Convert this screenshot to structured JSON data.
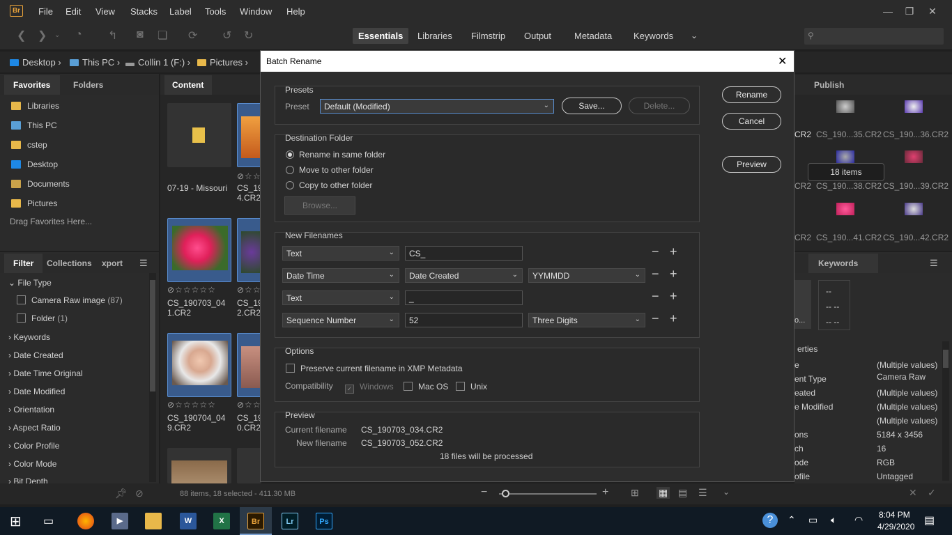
{
  "app": {
    "logo": "Br"
  },
  "menu": [
    "File",
    "Edit",
    "View",
    "Stacks",
    "Label",
    "Tools",
    "Window",
    "Help"
  ],
  "workspaces": [
    "Essentials",
    "Libraries",
    "Filmstrip",
    "Output",
    "Metadata",
    "Keywords"
  ],
  "path": [
    "Desktop",
    "This PC",
    "Collin 1 (F:)",
    "Pictures"
  ],
  "left_panel": {
    "tabs": [
      "Favorites",
      "Folders"
    ],
    "favorites": [
      "Libraries",
      "This PC",
      "cstep",
      "Desktop",
      "Documents",
      "Pictures"
    ],
    "drag_hint": "Drag Favorites Here...",
    "filter_tabs": [
      "Filter",
      "Collections",
      "xport"
    ],
    "filters": {
      "file_type": "File Type",
      "camera_raw": "Camera Raw image",
      "camera_raw_count": "(87)",
      "folder": "Folder",
      "folder_count": "(1)",
      "others": [
        "Keywords",
        "Date Created",
        "Date Time Original",
        "Date Modified",
        "Orientation",
        "Aspect Ratio",
        "Color Profile",
        "Color Mode",
        "Bit Depth"
      ]
    }
  },
  "content": {
    "tab": "Content",
    "items": {
      "folder_caption": "07-19 - Missouri",
      "c2_line1": "CS_19",
      "c2_line2": "4.CR2",
      "r2_line1": "CS_190703_04",
      "r2_line2": "1.CR2",
      "r2b_line1": "CS_19",
      "r2b_line2": "2.CR2",
      "r3_line1": "CS_190704_04",
      "r3_line2": "9.CR2",
      "r3b_line1": "CS_19",
      "r3b_line2": "0.CR2"
    },
    "stars": "⊘☆☆☆☆☆",
    "stars_short": "⊘☆☆"
  },
  "dialog": {
    "title": "Batch Rename",
    "presets": {
      "section": "Presets",
      "label": "Preset",
      "value": "Default (Modified)",
      "save": "Save...",
      "delete": "Delete..."
    },
    "buttons": {
      "rename": "Rename",
      "cancel": "Cancel",
      "preview": "Preview"
    },
    "destination": {
      "section": "Destination Folder",
      "same": "Rename in same folder",
      "move": "Move to other folder",
      "copy": "Copy to other folder",
      "browse": "Browse..."
    },
    "new_filenames": {
      "section": "New Filenames",
      "row1": {
        "type": "Text",
        "value": "CS_"
      },
      "row2": {
        "type": "Date Time",
        "field": "Date Created",
        "format": "YYMMDD"
      },
      "row3": {
        "type": "Text",
        "value": "_"
      },
      "row4": {
        "type": "Sequence Number",
        "value": "52",
        "format": "Three Digits"
      }
    },
    "options": {
      "section": "Options",
      "preserve": "Preserve current filename in XMP Metadata",
      "compat_label": "Compatibility",
      "windows": "Windows",
      "macos": "Mac OS",
      "unix": "Unix"
    },
    "preview": {
      "section": "Preview",
      "current_label": "Current filename",
      "current_value": "CS_190703_034.CR2",
      "new_label": "New filename",
      "new_value": "CS_190703_052.CR2",
      "count": "18 files will be processed"
    }
  },
  "right_panel": {
    "publish": "Publish",
    "thumbs": [
      "CR2",
      "CS_190...35.CR2",
      "CS_190...36.CR2",
      "CR2",
      "CS_190...38.CR2",
      "CS_190...39.CR2",
      "CR2",
      "CS_190...41.CR2",
      "CS_190...42.CR2"
    ],
    "badge": "18 items",
    "keywords": "Keywords",
    "dashes": [
      "--",
      "-- --",
      "-- --"
    ],
    "ellipsis": "o...",
    "props_title": "erties",
    "prop_labels": [
      "e",
      "ent Type",
      "eated",
      "e Modified",
      "",
      "ons",
      "ch",
      "ode",
      "ofile"
    ],
    "prop_values": [
      "(Multiple values)",
      "Camera Raw",
      "(Multiple values)",
      "(Multiple values)",
      "(Multiple values)",
      "5184 x 3456",
      "16",
      "RGB",
      "Untagged"
    ]
  },
  "status": {
    "text": "88 items, 18 selected - 411.30 MB"
  },
  "taskbar": {
    "time": "8:04 PM",
    "date": "4/29/2020"
  },
  "colors": {
    "accent": "#5a8ed0",
    "bridge_orange": "#e8a23a"
  }
}
